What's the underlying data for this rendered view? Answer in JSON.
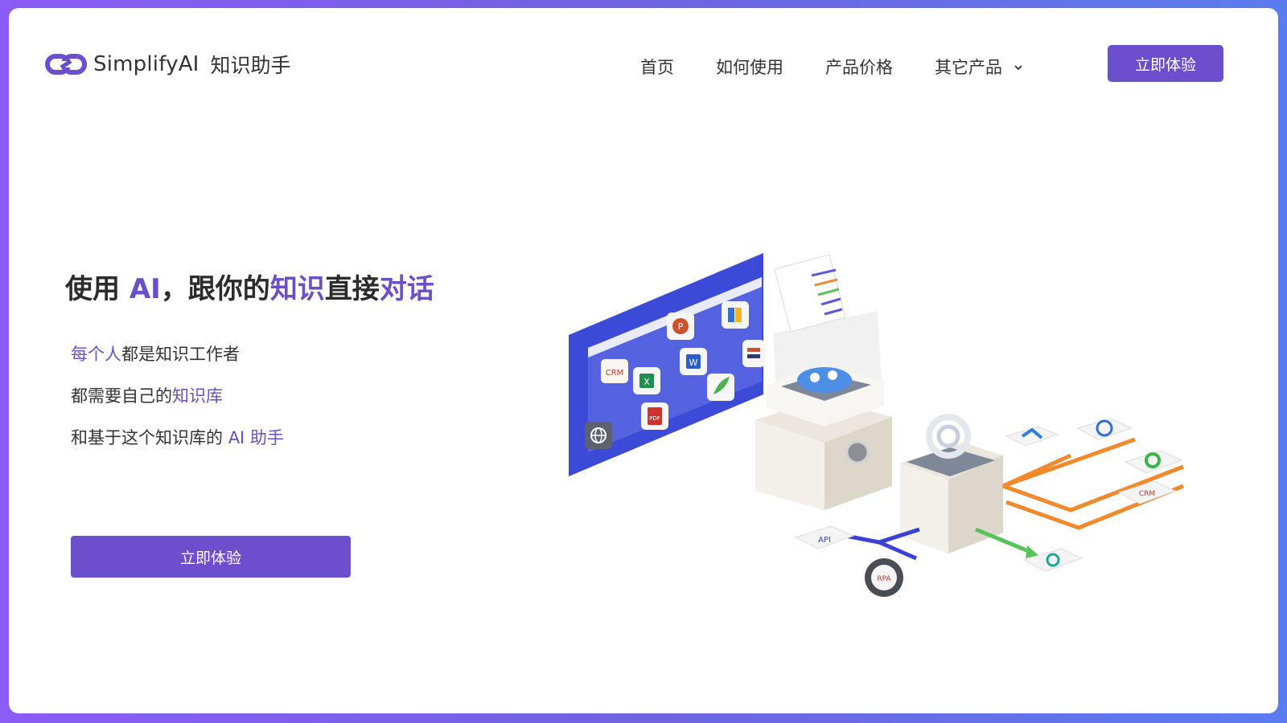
{
  "header": {
    "brand": "SimplifyAI",
    "product": "知识助手",
    "nav": [
      {
        "label": "首页"
      },
      {
        "label": "如何使用"
      },
      {
        "label": "产品价格"
      },
      {
        "label": "其它产品"
      }
    ],
    "cta": "立即体验"
  },
  "hero": {
    "title": {
      "p1": "使用 ",
      "h1": "AI",
      "p2": "，跟你的",
      "h2": "知识",
      "p3": "直接",
      "h3": "对话"
    },
    "line1": {
      "h": "每个人",
      "t": "都是知识工作者"
    },
    "line2": {
      "t": "都需要自己的",
      "h": "知识库"
    },
    "line3": {
      "t": "和基于这个知识库的 ",
      "h": "AI 助手"
    },
    "cta": "立即体验"
  },
  "illustration": {
    "labels": {
      "crm": "CRM",
      "ppt": "P",
      "word": "W",
      "excel": "X",
      "pdf": "PDF",
      "api": "API",
      "rpa": "RPA",
      "crm2": "CRM"
    }
  },
  "colors": {
    "accent": "#6b4fcc",
    "board": "#3b4bd8",
    "orange": "#f08a2c",
    "green": "#56c45a",
    "blue_arrow": "#3b40d8"
  }
}
